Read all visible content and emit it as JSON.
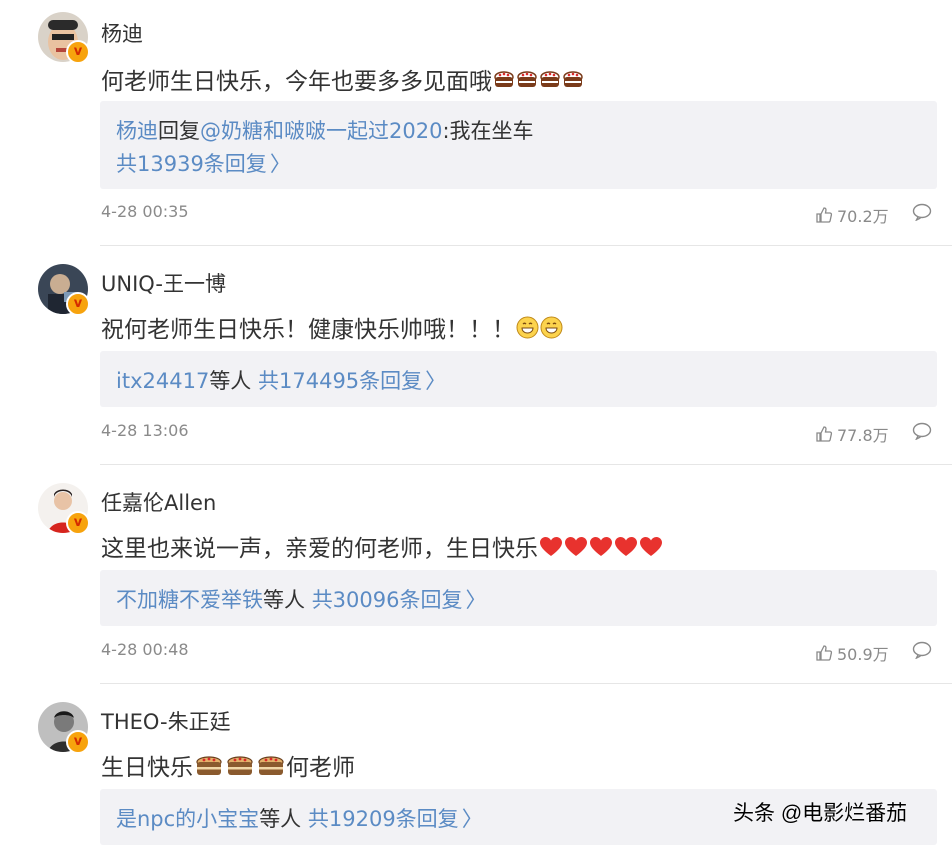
{
  "comments": [
    {
      "name": "杨迪",
      "text": "何老师生日快乐，今年也要多多见面哦",
      "emoji": [
        "cake",
        "cake",
        "cake",
        "cake"
      ],
      "reply_user": "杨迪",
      "reply_verb": "回复",
      "reply_mention": "@奶糖和啵啵一起过2020",
      "reply_text": ":我在坐车",
      "reply_count": "共13939条回复",
      "time": "4-28 00:35",
      "likes": "70.2万"
    },
    {
      "name": "UNIQ-王一博",
      "text": "祝何老师生日快乐！健康快乐帅哦！！！",
      "emoji": [
        "grin",
        "grin"
      ],
      "reply_users": "itx24417",
      "reply_suffix": "等人",
      "reply_count": "共174495条回复",
      "time": "4-28 13:06",
      "likes": "77.8万"
    },
    {
      "name": "任嘉伦Allen",
      "text": "这里也来说一声，亲爱的何老师，生日快乐",
      "emoji": [
        "heart",
        "heart",
        "heart",
        "heart",
        "heart"
      ],
      "reply_users": "不加糖不爱举铁",
      "reply_suffix": "等人",
      "reply_count": "共30096条回复",
      "time": "4-28 00:48",
      "likes": "50.9万"
    },
    {
      "name": "THEO-朱正廷",
      "text_before": "生日快乐",
      "emoji": [
        "cake",
        "cake",
        "cake"
      ],
      "text_after": "何老师",
      "reply_users": "是npc的小宝宝",
      "reply_suffix": "等人",
      "reply_count": "共19209条回复"
    }
  ],
  "watermark": "头条 @电影烂番茄",
  "colors": {
    "link": "#5b8bc4",
    "reply_bg": "#f2f2f5",
    "badge": "#f7a30d",
    "heart": "#e8322e"
  },
  "icons": [
    "thumb-up-icon",
    "comment-icon",
    "verified-badge-icon",
    "chevron-right-icon"
  ]
}
